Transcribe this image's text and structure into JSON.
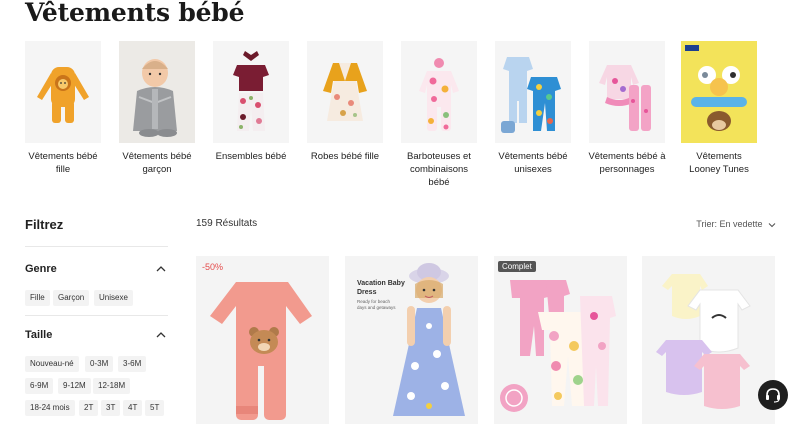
{
  "page": {
    "title": "Vêtements bébé"
  },
  "categories": [
    {
      "label": "Vêtements bébé fille",
      "icon": "orange-lion-romper-image"
    },
    {
      "label": "Vêtements bébé garçon",
      "icon": "baby-boy-photo-image"
    },
    {
      "label": "Ensembles bébé",
      "icon": "burgundy-outfit-set-image"
    },
    {
      "label": "Robes bébé fille",
      "icon": "yellow-cardigan-dress-image"
    },
    {
      "label": "Barboteuses et combinaisons bébé",
      "icon": "floral-romper-image"
    },
    {
      "label": "Vêtements bébé unisexes",
      "icon": "blue-pajama-set-image"
    },
    {
      "label": "Vêtements bébé à personnages",
      "icon": "pink-character-set-image"
    },
    {
      "label": "Vêtements Looney Tunes",
      "icon": "looney-tunes-poster-image"
    }
  ],
  "filters": {
    "title": "Filtrez",
    "genre": {
      "title": "Genre",
      "options": [
        "Fille",
        "Garçon",
        "Unisexe"
      ]
    },
    "taille": {
      "title": "Taille",
      "options": [
        "Nouveau-né",
        "0-3M",
        "3-6M",
        "6-9M",
        "9-12M",
        "12-18M",
        "18-24 mois",
        "2T",
        "3T",
        "4T",
        "5T"
      ]
    }
  },
  "results": {
    "count_label": "159 Résultats",
    "sort_label": "Trier: En vedette"
  },
  "products": [
    {
      "badge": "-50%",
      "icon": "pink-bear-sleeper-image"
    },
    {
      "promo_title": "Vacation Baby Dress",
      "promo_sub": "Ready for beach days and getaways",
      "icon": "blue-floral-dress-girl-image"
    },
    {
      "badge": "Complet",
      "icon": "pink-pajama-set-image"
    },
    {
      "icon": "pastel-bodysuits-image"
    }
  ],
  "colors": {
    "sale": "#e54b4b",
    "support_button": "#1f1f1f"
  },
  "support": {
    "icon": "headset-icon"
  }
}
